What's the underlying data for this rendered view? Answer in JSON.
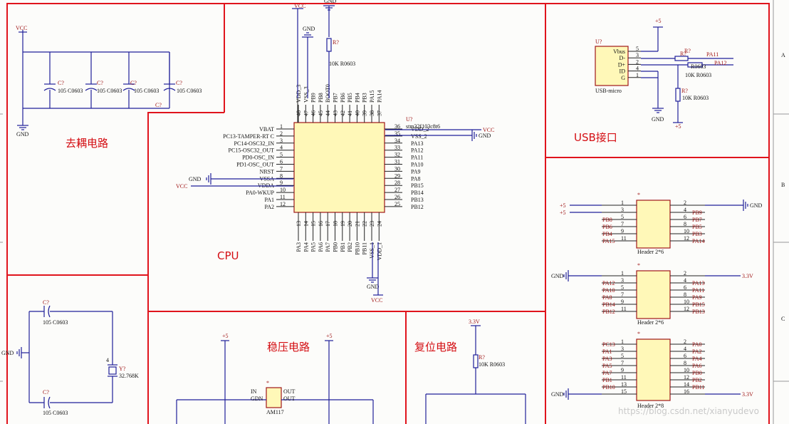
{
  "titles": {
    "decoupling": "去耦电路",
    "cpu": "CPU",
    "usb": "USB接口",
    "regulator": "稳压电路",
    "reset": "复位电路"
  },
  "grid_letters": [
    "A",
    "B",
    "C"
  ],
  "nets": {
    "vcc": "VCC",
    "gnd": "GND",
    "v5": "+5",
    "v33": "3.3V"
  },
  "decoupling": {
    "caps": [
      {
        "ref": "C?",
        "value": "105 C0603"
      },
      {
        "ref": "C?",
        "value": "105 C0603"
      },
      {
        "ref": "C?",
        "value": "105 C0603"
      },
      {
        "ref": "C?",
        "value": "105 C0603"
      }
    ],
    "footer_ref": "C?"
  },
  "crystal": {
    "cap_top": {
      "ref": "C?",
      "value": "105 C0603"
    },
    "cap_bottom": {
      "ref": "C?",
      "value": "105 C0603"
    },
    "ref": "Y?",
    "value": "32.768K",
    "pin4": "4"
  },
  "mcu": {
    "ref": "U?",
    "part": "stm32f103c8t6",
    "left_pins": [
      {
        "num": "1",
        "name": "VBAT"
      },
      {
        "num": "2",
        "name": "PC13-TAMPER-RT C"
      },
      {
        "num": "3",
        "name": "PC14-OSC32_IN"
      },
      {
        "num": "4",
        "name": "PC15-OSC32_OUT"
      },
      {
        "num": "5",
        "name": "PD0-OSC_IN"
      },
      {
        "num": "6",
        "name": "PD1-OSC_OUT"
      },
      {
        "num": "7",
        "name": "NRST"
      },
      {
        "num": "8",
        "name": "VSSA"
      },
      {
        "num": "9",
        "name": "VDDA"
      },
      {
        "num": "10",
        "name": "PA0-WKUP"
      },
      {
        "num": "11",
        "name": "PA1"
      },
      {
        "num": "12",
        "name": "PA2"
      }
    ],
    "right_pins": [
      {
        "num": "36",
        "name": "VDD_2"
      },
      {
        "num": "35",
        "name": "VSS_2"
      },
      {
        "num": "34",
        "name": "PA13"
      },
      {
        "num": "33",
        "name": "PA12"
      },
      {
        "num": "32",
        "name": "PA11"
      },
      {
        "num": "31",
        "name": "PA10"
      },
      {
        "num": "30",
        "name": "PA9"
      },
      {
        "num": "29",
        "name": "PA8"
      },
      {
        "num": "28",
        "name": "PB15"
      },
      {
        "num": "27",
        "name": "PB14"
      },
      {
        "num": "26",
        "name": "PB13"
      },
      {
        "num": "25",
        "name": "PB12"
      }
    ],
    "top_pins": [
      {
        "num": "48",
        "name": "VDD_3"
      },
      {
        "num": "47",
        "name": "VSS_3"
      },
      {
        "num": "46",
        "name": "PB9"
      },
      {
        "num": "45",
        "name": "PB8"
      },
      {
        "num": "44",
        "name": "BOOT0"
      },
      {
        "num": "43",
        "name": "PB7"
      },
      {
        "num": "42",
        "name": "PB6"
      },
      {
        "num": "41",
        "name": "PB5"
      },
      {
        "num": "40",
        "name": "PB4"
      },
      {
        "num": "39",
        "name": "PB3"
      },
      {
        "num": "38",
        "name": "PA15"
      },
      {
        "num": "37",
        "name": "PA14"
      }
    ],
    "bottom_pins": [
      {
        "num": "13",
        "name": "PA3"
      },
      {
        "num": "14",
        "name": "PA4"
      },
      {
        "num": "15",
        "name": "PA5"
      },
      {
        "num": "16",
        "name": "PA6"
      },
      {
        "num": "17",
        "name": "PA7"
      },
      {
        "num": "18",
        "name": "PB0"
      },
      {
        "num": "19",
        "name": "PB1"
      },
      {
        "num": "20",
        "name": "PB2"
      },
      {
        "num": "21",
        "name": "PB10"
      },
      {
        "num": "22",
        "name": "PB11"
      },
      {
        "num": "23",
        "name": "VSS_1"
      },
      {
        "num": "24",
        "name": "VDD_1"
      }
    ],
    "boot_resistor": {
      "ref": "R?",
      "value": "10K R0603"
    }
  },
  "usb": {
    "ref": "U?",
    "part": "USB-micro",
    "pins": [
      {
        "num": "5",
        "name": "Vbus"
      },
      {
        "num": "3",
        "name": "D-"
      },
      {
        "num": "2",
        "name": "D+"
      },
      {
        "num": "4",
        "name": "ID"
      },
      {
        "num": "1",
        "name": "G"
      }
    ],
    "r_dminus": {
      "ref": "R?",
      "value": "R0603",
      "net": "PA11"
    },
    "r_dplus": {
      "ref": "R?",
      "value": "10K R0603",
      "net": "PA12"
    },
    "r_pull": {
      "ref": "R?",
      "value": "10K R0603"
    }
  },
  "headers": [
    {
      "ref": "*",
      "part": "Header 2*6",
      "rows": [
        {
          "l": "",
          "ln": "1",
          "rn": "2",
          "r": ""
        },
        {
          "l": "",
          "ln": "3",
          "rn": "4",
          "r": "PB9"
        },
        {
          "l": "PB8",
          "ln": "5",
          "rn": "6",
          "r": "PB7"
        },
        {
          "l": "PB6",
          "ln": "7",
          "rn": "8",
          "r": "PB5"
        },
        {
          "l": "PB4",
          "ln": "9",
          "rn": "10",
          "r": "PB3"
        },
        {
          "l": "PA15",
          "ln": "11",
          "rn": "12",
          "r": "PA14"
        }
      ]
    },
    {
      "ref": "*",
      "part": "Header 2*6",
      "rows": [
        {
          "l": "",
          "ln": "1",
          "rn": "2",
          "r": ""
        },
        {
          "l": "PA12",
          "ln": "3",
          "rn": "4",
          "r": "PA13"
        },
        {
          "l": "PA10",
          "ln": "5",
          "rn": "6",
          "r": "PA11"
        },
        {
          "l": "PA8",
          "ln": "7",
          "rn": "8",
          "r": "PA9"
        },
        {
          "l": "PB14",
          "ln": "9",
          "rn": "10",
          "r": "PB15"
        },
        {
          "l": "PB12",
          "ln": "11",
          "rn": "12",
          "r": "PB13"
        }
      ]
    },
    {
      "ref": "*",
      "part": "Header 2*8",
      "rows": [
        {
          "l": "PC13",
          "ln": "1",
          "rn": "2",
          "r": "PA0"
        },
        {
          "l": "PA1",
          "ln": "3",
          "rn": "4",
          "r": "PA2"
        },
        {
          "l": "PA3",
          "ln": "5",
          "rn": "6",
          "r": "PA4"
        },
        {
          "l": "PA5",
          "ln": "7",
          "rn": "8",
          "r": "PA6"
        },
        {
          "l": "PA7",
          "ln": "9",
          "rn": "10",
          "r": "PB0"
        },
        {
          "l": "PB1",
          "ln": "11",
          "rn": "12",
          "r": "PB2"
        },
        {
          "l": "PB10",
          "ln": "13",
          "rn": "14",
          "r": "PB11"
        },
        {
          "l": "",
          "ln": "15",
          "rn": "16",
          "r": ""
        }
      ]
    }
  ],
  "regulator": {
    "ref": "*",
    "part": "AM117",
    "pin_in": "IN",
    "pin_gnd": "GDN",
    "pin_out1": "OUT",
    "pin_out2": "OUT"
  },
  "reset": {
    "ref": "R?",
    "value": "10K R0603"
  },
  "watermark": "https://blog.csdn.net/xianyudevo"
}
